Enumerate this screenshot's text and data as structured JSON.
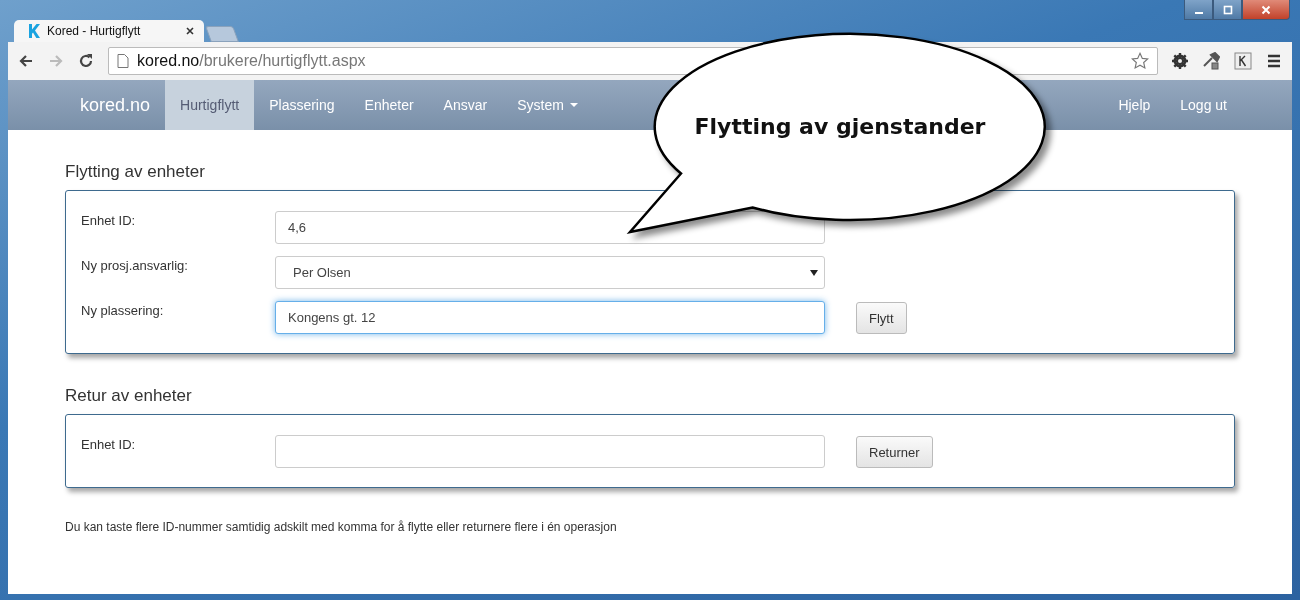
{
  "browser": {
    "tabs": [
      {
        "title": "Kored - Hurtigflytt",
        "selected": true
      }
    ],
    "url_domain": "kored.no",
    "url_path": "/brukere/hurtigflytt.aspx"
  },
  "navbar": {
    "brand": "kored.no",
    "items": [
      {
        "label": "Hurtigflytt",
        "selected": true,
        "dropdown": false
      },
      {
        "label": "Plassering",
        "selected": false,
        "dropdown": false
      },
      {
        "label": "Enheter",
        "selected": false,
        "dropdown": false
      },
      {
        "label": "Ansvar",
        "selected": false,
        "dropdown": false
      },
      {
        "label": "System",
        "selected": false,
        "dropdown": true
      }
    ],
    "right_items": [
      "Hjelp",
      "Logg ut"
    ]
  },
  "sections": [
    {
      "title": "Flytting av enheter",
      "button": "Flytt",
      "fields": [
        {
          "label": "Enhet ID:",
          "kind": "text",
          "value": "4,6",
          "focused": false
        },
        {
          "label": "Ny prosj.ansvarlig:",
          "kind": "select",
          "value": "Per Olsen",
          "focused": false
        },
        {
          "label": "Ny plassering:",
          "kind": "text",
          "value": "Kongens gt. 12",
          "focused": true
        }
      ]
    },
    {
      "title": "Retur av enheter",
      "button": "Returner",
      "fields": [
        {
          "label": "Enhet ID:",
          "kind": "text",
          "focused": false
        }
      ]
    }
  ],
  "help_text": "Du kan taste flere ID-nummer samtidig adskilt med komma for å flytte eller returnere flere i én operasjon",
  "callout": {
    "text": "Flytting av gjenstander"
  }
}
